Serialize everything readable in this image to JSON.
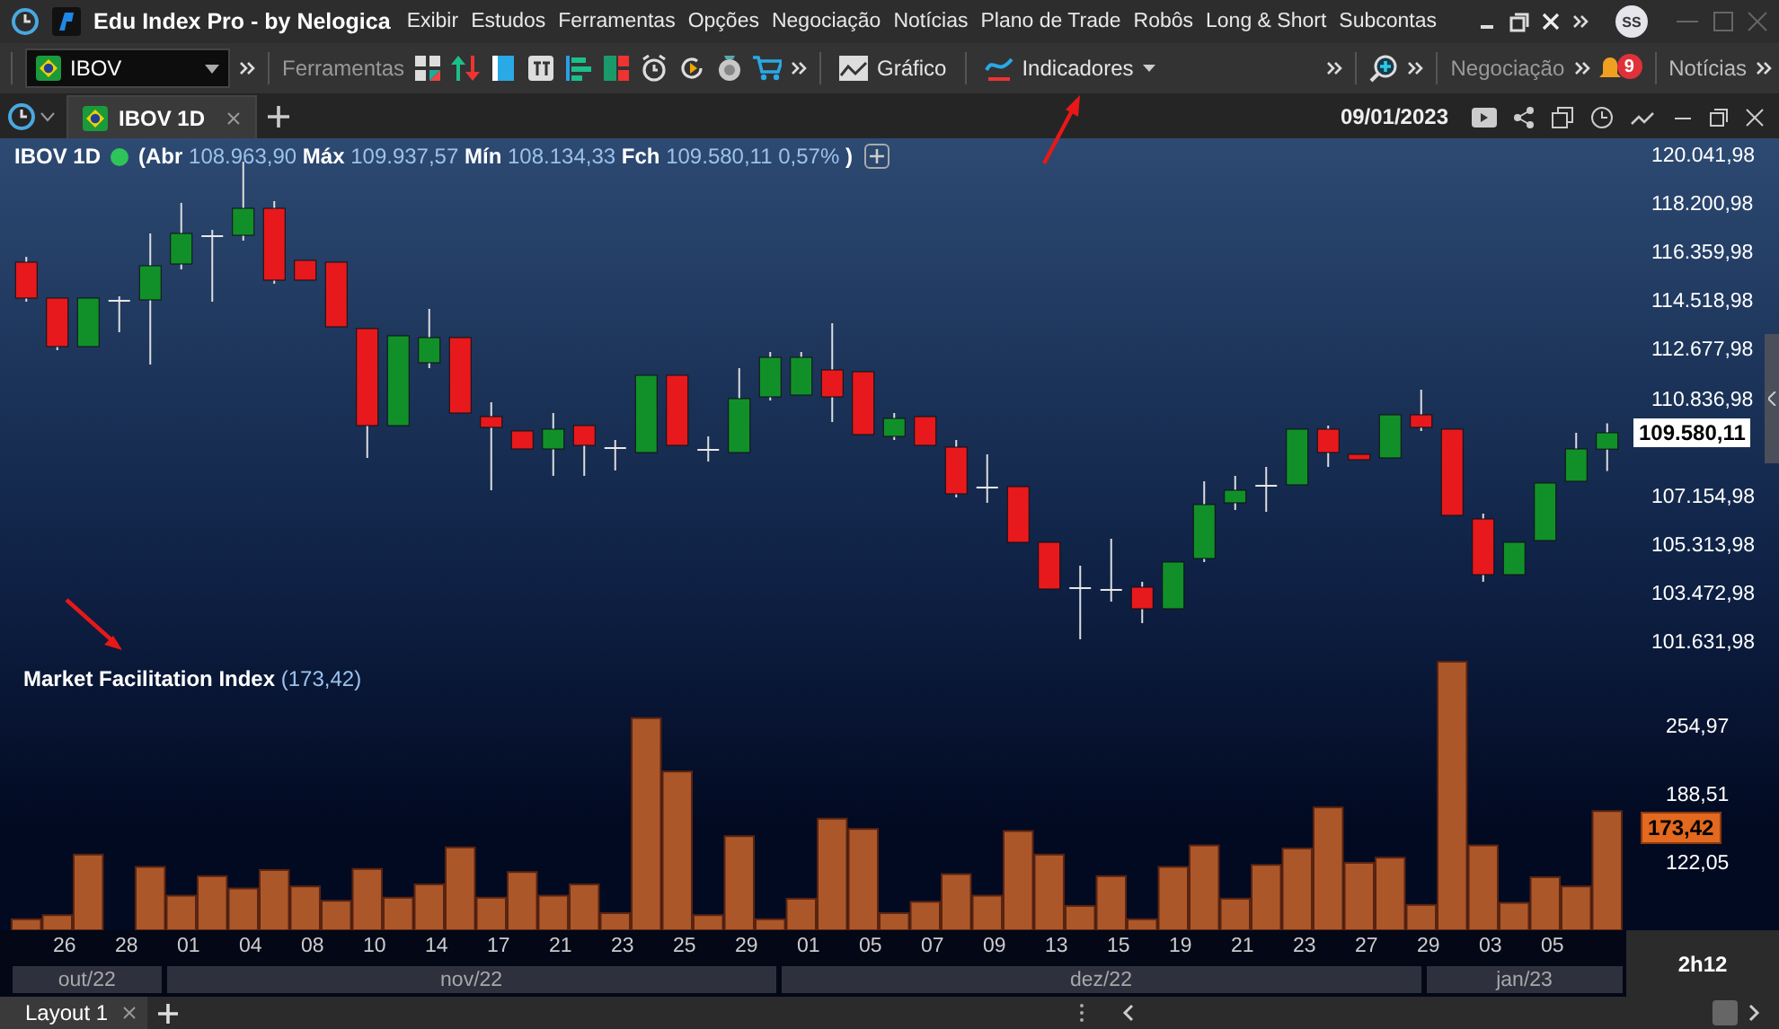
{
  "app": {
    "title": "Edu Index Pro - by Nelogica",
    "menu": [
      "Exibir",
      "Estudos",
      "Ferramentas",
      "Opções",
      "Negociação",
      "Notícias",
      "Plano de Trade",
      "Robôs",
      "Long & Short",
      "Subcontas"
    ],
    "avatar": "SS"
  },
  "toolbar": {
    "symbol": "IBOV",
    "tools_label": "Ferramentas",
    "chart_button": "Gráfico",
    "indicators_button": "Indicadores",
    "trading_label": "Negociação",
    "notifications_count": "9",
    "news_label": "Notícias"
  },
  "tabs": [
    {
      "label": "IBOV 1D",
      "selected": true
    }
  ],
  "chart_header": {
    "date": "09/01/2023"
  },
  "price_pane": {
    "title": "IBOV 1D",
    "quote": "**(Abr** 108.963,90 **Máx** 109.937,57 **Mín** 108.134,33 **Fch** 109.580,11 0,57% **)**",
    "last_price": "109.580,11",
    "chart_data": {
      "type": "candlestick",
      "ohlc": [
        [
          116034,
          116238,
          114540,
          114676
        ],
        [
          114676,
          114676,
          112706,
          112842
        ],
        [
          112842,
          114676,
          112842,
          114676
        ],
        [
          114608,
          114744,
          113385,
          114608
        ],
        [
          114608,
          117121,
          112162,
          115898
        ],
        [
          115966,
          118276,
          115762,
          117121
        ],
        [
          117053,
          117257,
          114540,
          117053
        ],
        [
          117053,
          119838,
          116849,
          118072
        ],
        [
          118072,
          118344,
          115219,
          115355
        ],
        [
          116102,
          116102,
          115355,
          115355
        ],
        [
          116034,
          116034,
          113589,
          113589
        ],
        [
          113521,
          113521,
          108630,
          109853
        ],
        [
          109853,
          113249,
          109853,
          113249
        ],
        [
          112230,
          114268,
          112026,
          113181
        ],
        [
          113181,
          113181,
          110328,
          110328
        ],
        [
          110192,
          110736,
          107407,
          109785
        ],
        [
          109649,
          109649,
          108969,
          108969
        ],
        [
          108969,
          110328,
          107951,
          109717
        ],
        [
          109853,
          109853,
          107951,
          109105
        ],
        [
          109037,
          109309,
          108154,
          109037
        ],
        [
          108834,
          111755,
          108834,
          111755
        ],
        [
          111755,
          111755,
          109105,
          109105
        ],
        [
          108969,
          109445,
          108494,
          108969
        ],
        [
          108834,
          112026,
          108834,
          110872
        ],
        [
          110939,
          112638,
          110804,
          112434
        ],
        [
          111007,
          112638,
          111007,
          112434
        ],
        [
          111958,
          113725,
          109988,
          110939
        ],
        [
          111890,
          111890,
          109513,
          109513
        ],
        [
          109445,
          110328,
          109309,
          110124
        ],
        [
          110192,
          110192,
          109105,
          109105
        ],
        [
          109037,
          109309,
          107135,
          107271
        ],
        [
          107543,
          108766,
          106932,
          107543
        ],
        [
          107543,
          107543,
          105437,
          105437
        ],
        [
          105437,
          105437,
          103671,
          103671
        ],
        [
          103739,
          104554,
          101769,
          103739
        ],
        [
          103671,
          105573,
          103195,
          103671
        ],
        [
          103739,
          103943,
          102380,
          102924
        ],
        [
          102924,
          104690,
          102924,
          104690
        ],
        [
          104826,
          107747,
          104690,
          106864
        ],
        [
          106932,
          107951,
          106660,
          107407
        ],
        [
          107611,
          108290,
          106592,
          107611
        ],
        [
          107611,
          109717,
          107611,
          109717
        ],
        [
          109717,
          109853,
          108290,
          108834
        ],
        [
          108766,
          108766,
          108562,
          108562
        ],
        [
          108630,
          110260,
          108630,
          110260
        ],
        [
          110260,
          111211,
          109649,
          109785
        ],
        [
          109717,
          109717,
          106456,
          106456
        ],
        [
          106320,
          106524,
          103943,
          104214
        ],
        [
          104214,
          105437,
          104214,
          105437
        ],
        [
          105505,
          107679,
          105505,
          107679
        ],
        [
          107747,
          109581,
          107747,
          108969
        ],
        [
          108963.9,
          109937.57,
          108134.33,
          109580.11
        ]
      ],
      "ylim": [
        101631.98,
        120041.98
      ],
      "yticks": [
        {
          "value": 120041.98,
          "label": "120.041,98"
        },
        {
          "value": 118200.98,
          "label": "118.200,98"
        },
        {
          "value": 116359.98,
          "label": "116.359,98"
        },
        {
          "value": 114518.98,
          "label": "114.518,98"
        },
        {
          "value": 112677.98,
          "label": "112.677,98"
        },
        {
          "value": 110836.98,
          "label": "110.836,98"
        },
        {
          "value": 107154.98,
          "label": "107.154,98"
        },
        {
          "value": 105313.98,
          "label": "105.313,98"
        },
        {
          "value": 103472.98,
          "label": "103.472,98"
        },
        {
          "value": 101631.98,
          "label": "101.631,98"
        }
      ]
    }
  },
  "indicator_pane": {
    "title": "**Market Facilitation Index** (173,42)",
    "last_value": "173,42",
    "chart_data": {
      "type": "bar",
      "values": [
        68,
        72,
        131,
        null,
        119,
        91,
        110,
        98,
        116,
        100,
        86,
        117,
        89,
        102,
        138,
        89,
        114,
        91,
        102,
        74,
        264,
        212,
        72,
        149,
        68,
        88,
        166,
        156,
        74,
        85,
        112,
        91,
        154,
        131,
        81,
        110,
        68,
        119,
        140,
        88,
        121,
        137,
        177,
        123,
        128,
        82,
        319,
        140,
        84,
        109,
        100,
        173.42
      ],
      "ylim": [
        57.3,
        321
      ],
      "yticks": [
        {
          "value": 254.97,
          "label": "254,97"
        },
        {
          "value": 188.51,
          "label": "188,51"
        },
        {
          "value": 122.05,
          "label": "122,05"
        }
      ]
    }
  },
  "time_axis": {
    "days": [
      "26",
      "28",
      "01",
      "04",
      "08",
      "10",
      "14",
      "17",
      "21",
      "23",
      "25",
      "29",
      "01",
      "05",
      "07",
      "09",
      "13",
      "15",
      "19",
      "21",
      "23",
      "27",
      "29",
      "03",
      "05"
    ],
    "months": [
      "out/22",
      "nov/22",
      "dez/22",
      "jan/23"
    ]
  },
  "timeframe": "2h12",
  "layouts": [
    {
      "label": "Layout 1",
      "selected": true
    }
  ]
}
